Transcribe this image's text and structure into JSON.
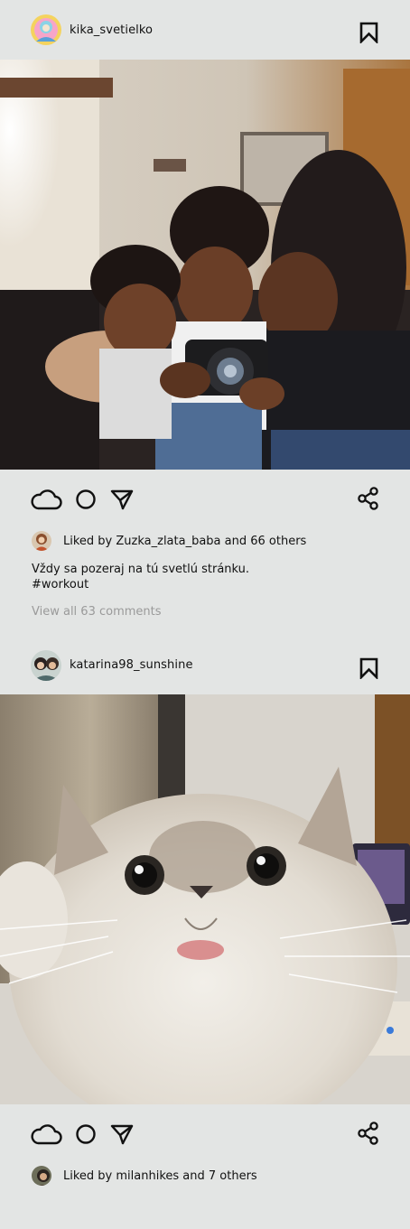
{
  "posts": [
    {
      "username": "kika_svetielko",
      "liked_by": "Liked by Zuzka_zlata_baba and 66 others",
      "caption": "Vždy sa pozeraj na  tú svetlú stránku.\n#workout",
      "view_comments": "View all 63 comments"
    },
    {
      "username": "katarina98_sunshine",
      "liked_by": "Liked by milanhikes and 7 others"
    }
  ],
  "icons": {
    "bookmark": "bookmark-icon",
    "like": "cloud-like-icon",
    "comment": "circle-comment-icon",
    "send": "send-triangle-icon",
    "share": "share-icon"
  },
  "colors": {
    "background": "#e3e5e4",
    "text": "#111111",
    "muted": "#9a9a9a"
  }
}
